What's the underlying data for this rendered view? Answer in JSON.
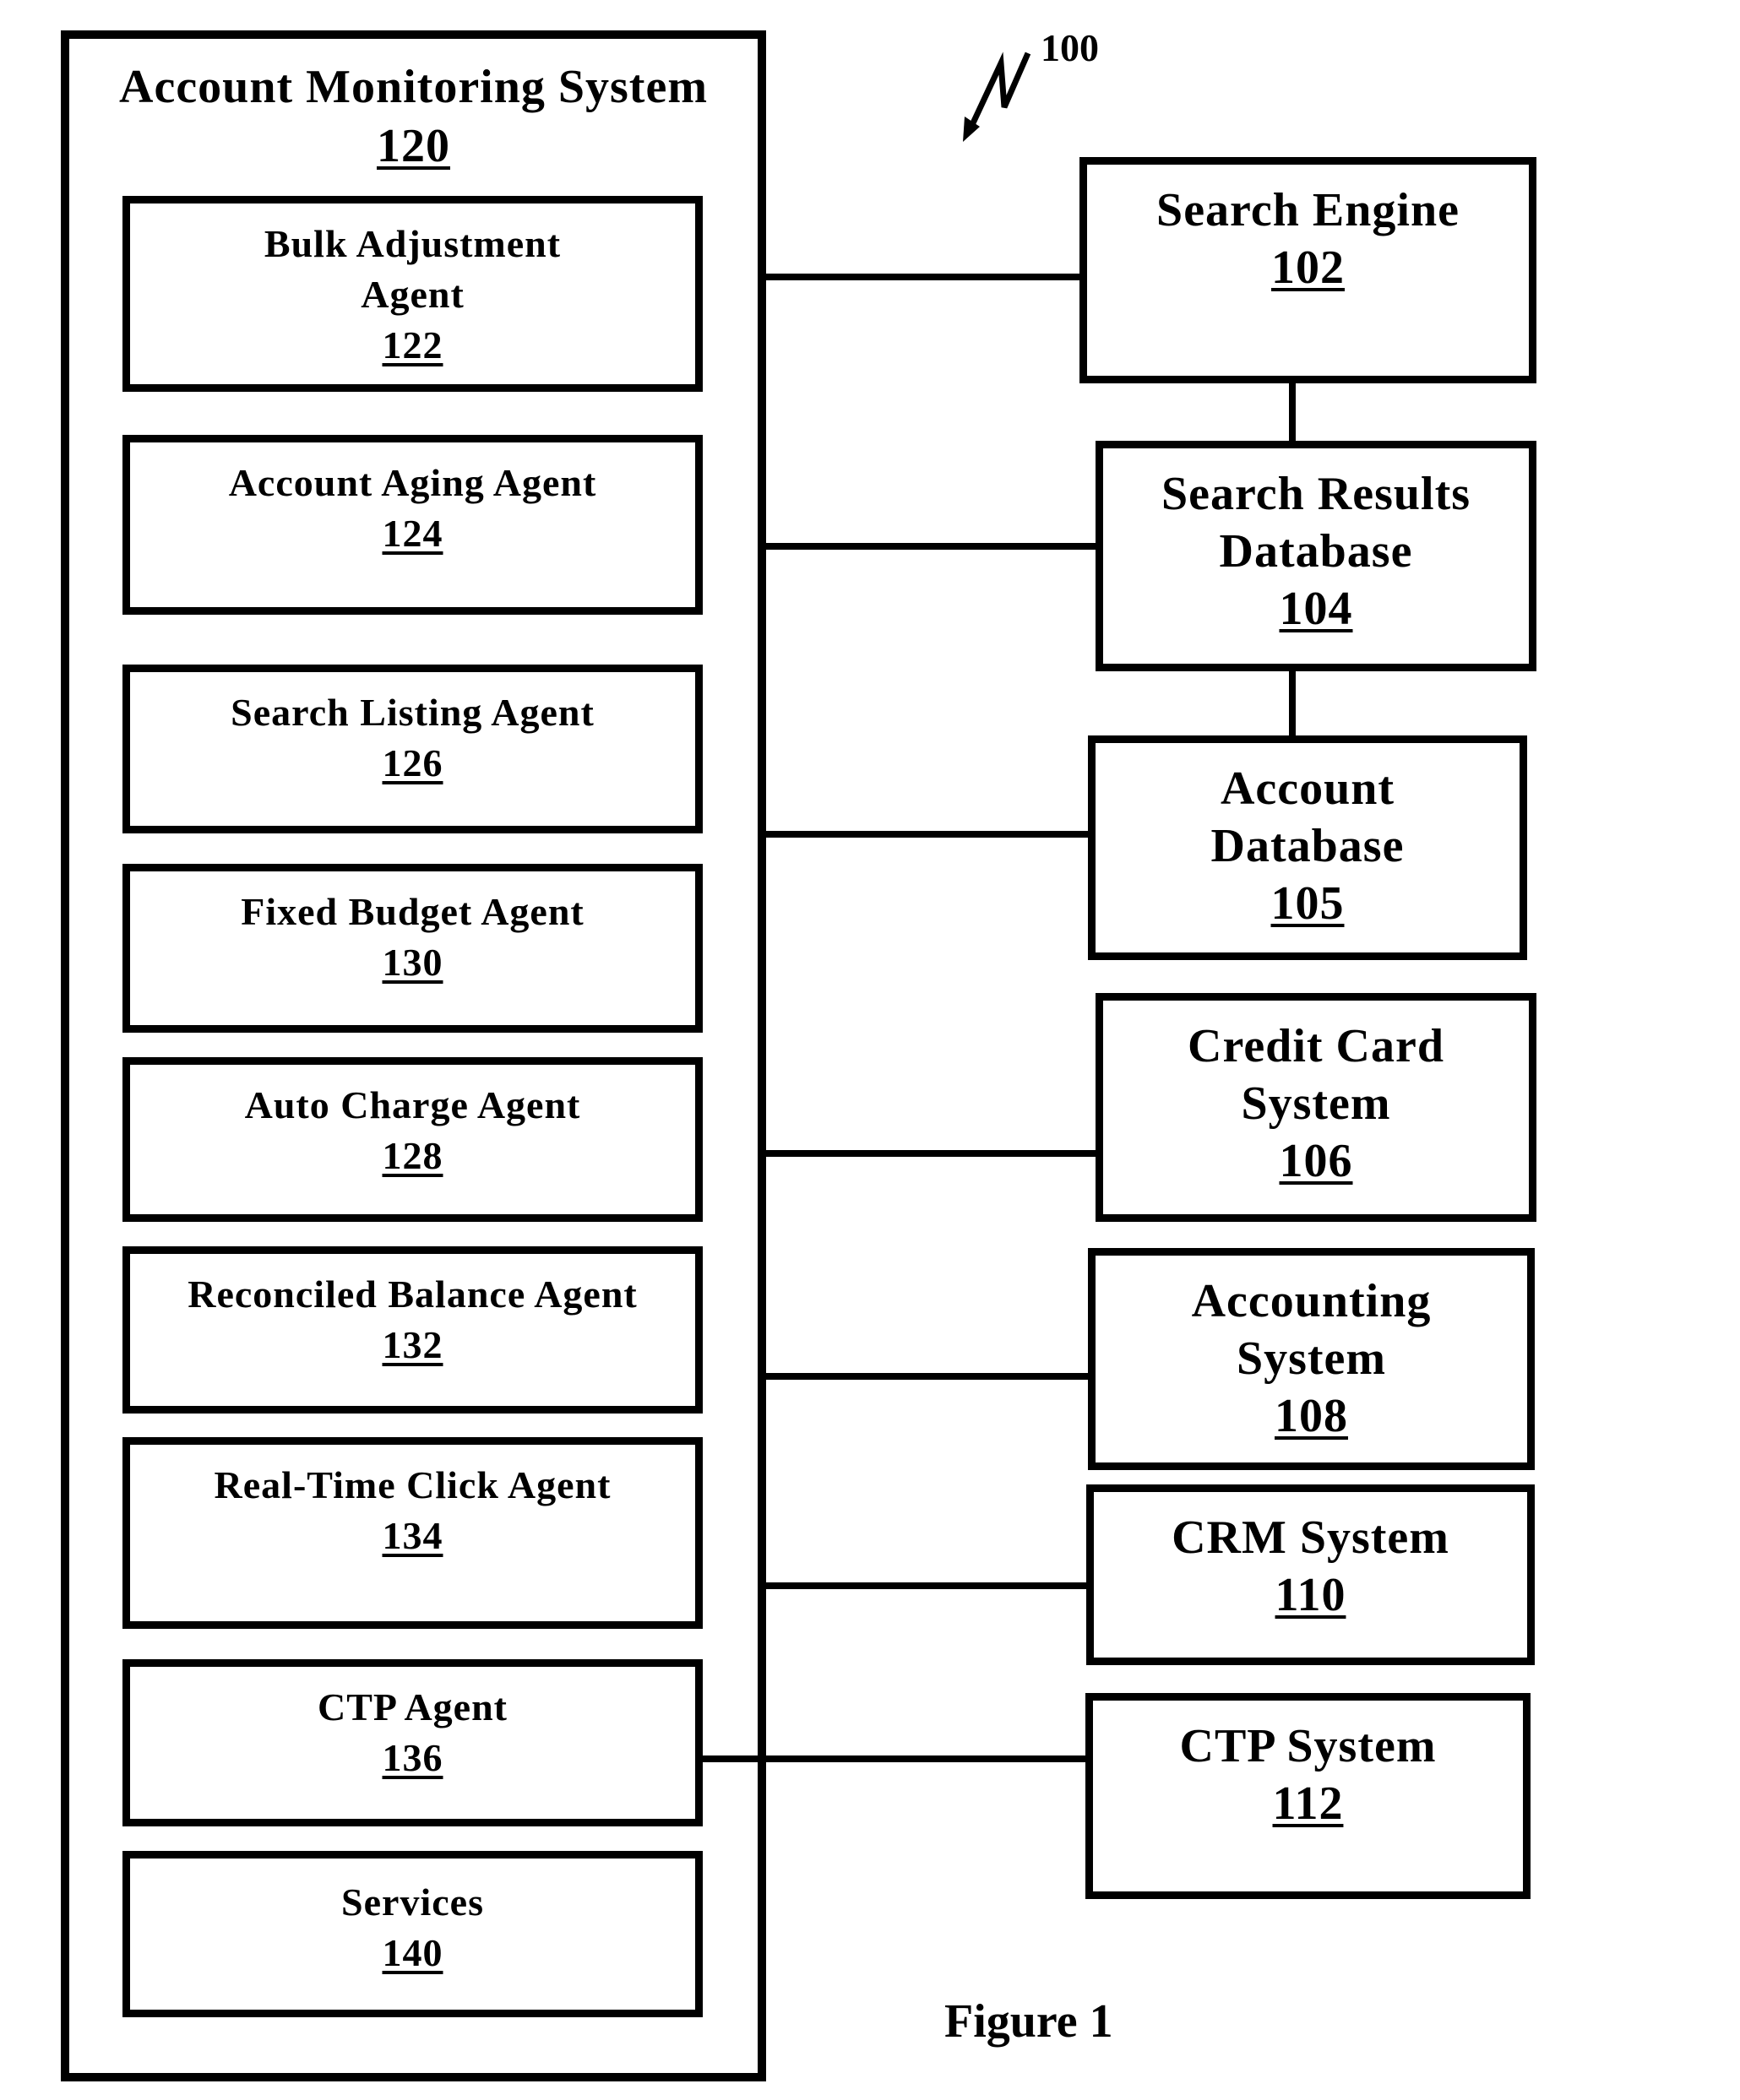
{
  "figure": {
    "reference_number": "100",
    "caption": "Figure 1"
  },
  "account_monitoring_system": {
    "title": "Account Monitoring System",
    "ref": "120",
    "agents": [
      {
        "label": "Bulk Adjustment\nAgent",
        "ref": "122"
      },
      {
        "label": "Account Aging Agent",
        "ref": "124"
      },
      {
        "label": "Search Listing Agent",
        "ref": "126"
      },
      {
        "label": "Fixed Budget Agent",
        "ref": "130"
      },
      {
        "label": "Auto Charge Agent",
        "ref": "128"
      },
      {
        "label": "Reconciled Balance Agent",
        "ref": "132"
      },
      {
        "label": "Real-Time Click Agent",
        "ref": "134"
      },
      {
        "label": "CTP Agent",
        "ref": "136"
      },
      {
        "label": "Services",
        "ref": "140"
      }
    ]
  },
  "external_systems": [
    {
      "label": "Search Engine",
      "ref": "102"
    },
    {
      "label": "Search Results\nDatabase",
      "ref": "104"
    },
    {
      "label": "Account\nDatabase",
      "ref": "105"
    },
    {
      "label": "Credit Card\nSystem",
      "ref": "106"
    },
    {
      "label": "Accounting\nSystem",
      "ref": "108"
    },
    {
      "label": "CRM System",
      "ref": "110"
    },
    {
      "label": "CTP System",
      "ref": "112"
    }
  ],
  "connections": [
    {
      "from": "120",
      "to": "102"
    },
    {
      "from": "120",
      "to": "104"
    },
    {
      "from": "120",
      "to": "105"
    },
    {
      "from": "120",
      "to": "106"
    },
    {
      "from": "120",
      "to": "108"
    },
    {
      "from": "120",
      "to": "110"
    },
    {
      "from": "136",
      "to": "112"
    },
    {
      "from": "102",
      "to": "104"
    },
    {
      "from": "104",
      "to": "105"
    }
  ]
}
